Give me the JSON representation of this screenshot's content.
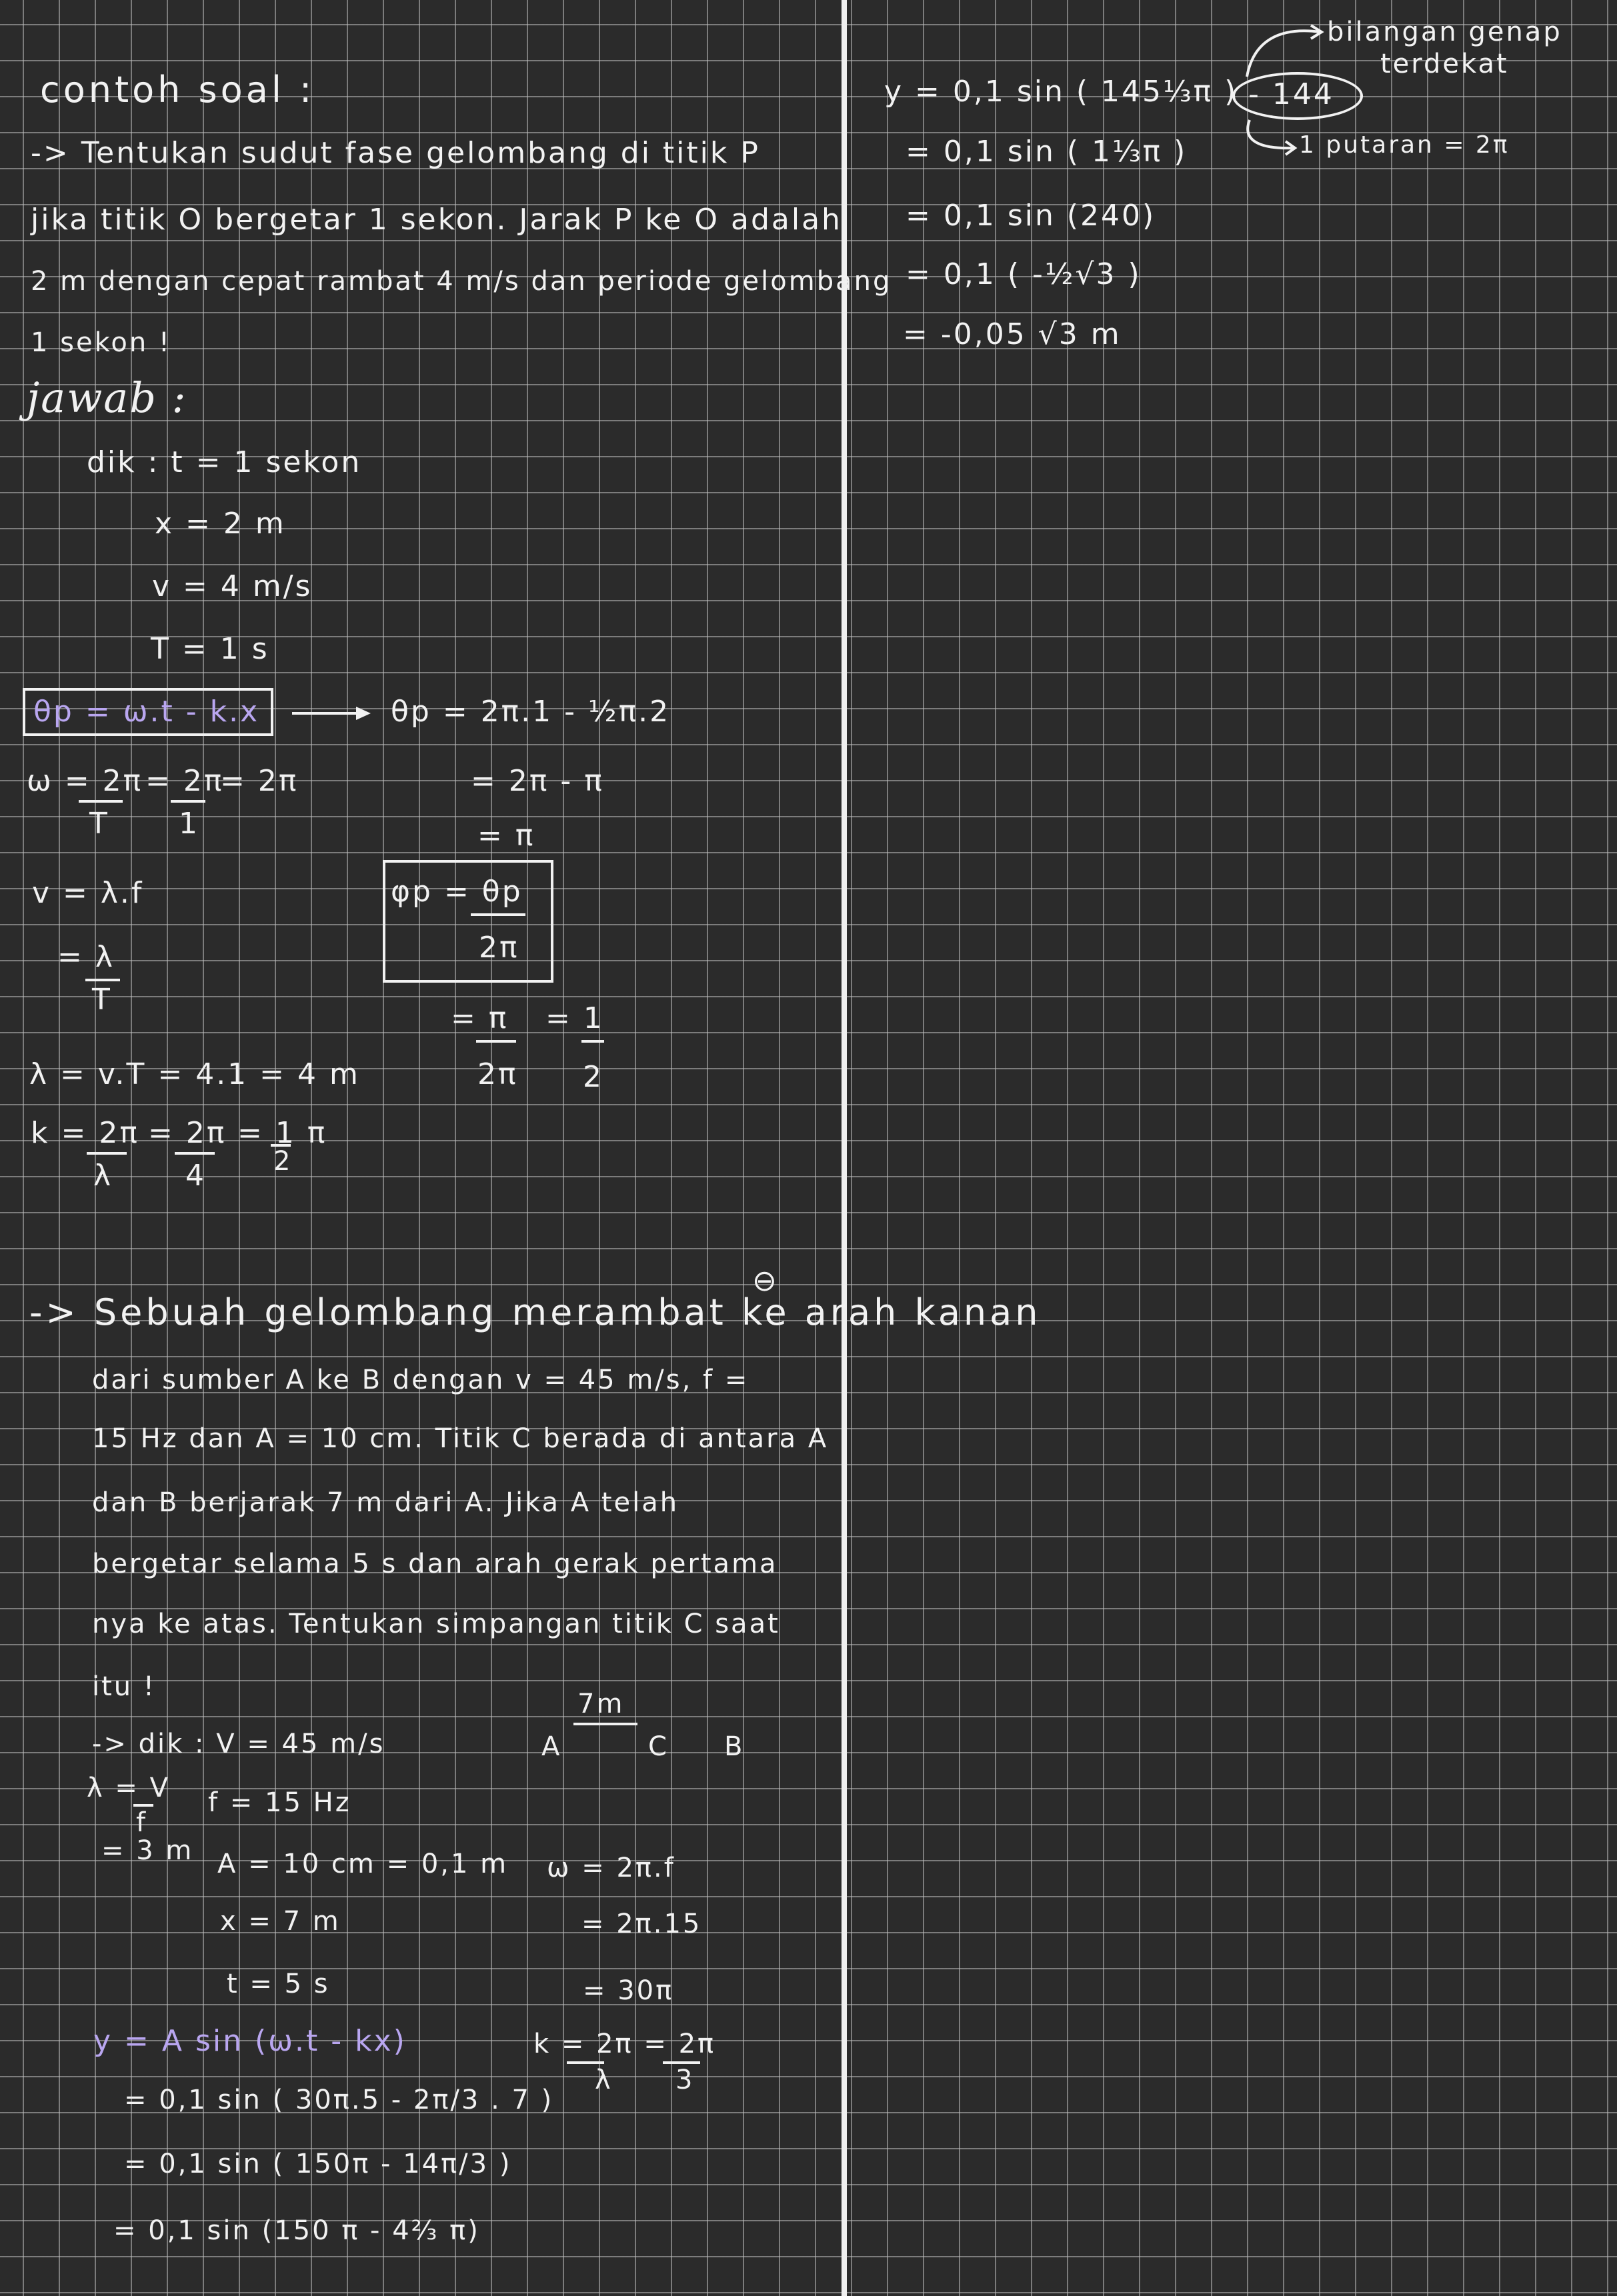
{
  "left": {
    "heading": "contoh soal :",
    "problem1": {
      "line1": "-> Tentukan sudut fase gelombang di titik P",
      "line2": "jika titik O bergetar 1 sekon. Jarak P ke O adalah",
      "line3": "2 m dengan cepat rambat 4 m/s dan periode gelombang",
      "line4": "1 sekon !"
    },
    "jawab": "jawab :",
    "dik": {
      "t": "dik : t = 1 sekon",
      "x": "x = 2 m",
      "v": "v = 4 m/s",
      "T": "T = 1 s"
    },
    "theta_formula": "θp = ω.t - k.x",
    "theta_calc1": "θp = 2π.1 - ½π.2",
    "theta_calc2": "= 2π - π",
    "theta_calc3": "= π",
    "omega_num": "ω = 2π",
    "omega_den": "T",
    "omega_eq2_num": "= 2π",
    "omega_eq2_den": "1",
    "omega_eq3": "= 2π",
    "v_eq": "v = λ.f",
    "v_eq2_num": "= λ",
    "v_eq2_den": "T",
    "phase_num": "φp = θp",
    "phase_den": "2π",
    "phase_res_num": "= π",
    "phase_res_den": "2π",
    "phase_res2_num": "= 1",
    "phase_res2_den": "2",
    "lambda_eq": "λ = v.T = 4.1 = 4 m",
    "k_num": "k = 2π",
    "k_den": "λ",
    "k_eq2_num": "= 2π",
    "k_eq2_den": "4",
    "k_eq3_num": "= 1 π",
    "k_eq3_den": "2",
    "problem2": {
      "minus_mark": "⊖",
      "line1": "->   Sebuah gelombang merambat ke arah kanan",
      "line2": "dari sumber A ke B dengan  v = 45 m/s, f =",
      "line3": "15 Hz dan A = 10 cm. Titik C berada di antara A",
      "line4": "dan B berjarak  7 m dari A. Jika A telah",
      "line5": "bergetar selama 5 s dan arah gerak pertama",
      "line6": "nya ke atas. Tentukan simpangan titik C saat",
      "line7": "itu !"
    },
    "diagram": {
      "dist": "7m",
      "A": "A",
      "C": "C",
      "B": "B"
    },
    "dik2": {
      "v": "-> dik : V = 45 m/s",
      "f": "f = 15 Hz",
      "lambda_num": "λ = V",
      "lambda_den": "f",
      "lambda_res": "= 3 m",
      "A": "A = 10 cm = 0,1 m",
      "x": "x = 7 m",
      "t": "t = 5 s"
    },
    "omega2": {
      "l1": "ω = 2π.f",
      "l2": "= 2π.15",
      "l3": "= 30π"
    },
    "k2": {
      "num": "k = 2π = 2π",
      "den": "λ      3"
    },
    "y_formula": "y = A sin (ω.t - kx)",
    "y_steps": {
      "s1": "= 0,1 sin ( 30π.5 - 2π/3 . 7 )",
      "s2": "= 0,1 sin ( 150π - 14π/3 )",
      "s3": "= 0,1 sin (150 π - 4⅔ π)"
    }
  },
  "right": {
    "lines": {
      "l1": "y = 0,1 sin ( 145⅓π )",
      "l2": "= 0,1 sin ( 1⅓π )",
      "l3": "= 0,1 sin (240)",
      "l4": "= 0,1 ( -½√3 )",
      "l5": "= -0,05 √3 m"
    },
    "circled": "- 144",
    "note_top1": "bilangan genap",
    "note_top2": "terdekat",
    "note_bottom": "1 putaran = 2π"
  }
}
